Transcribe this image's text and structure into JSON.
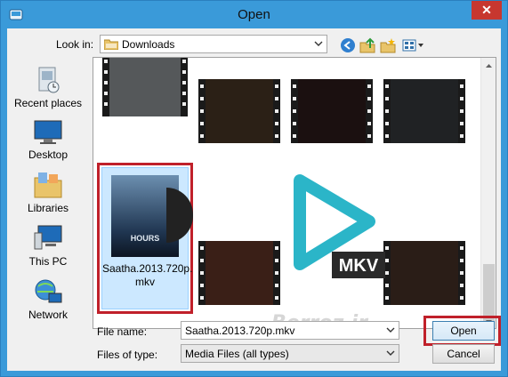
{
  "window": {
    "title": "Open",
    "close_glyph": "✕",
    "title_bar_color": "#3a9ad9"
  },
  "lookin": {
    "label": "Look in:",
    "value": "Downloads"
  },
  "toolbar": {
    "icons": [
      "back-icon",
      "up-folder-icon",
      "new-folder-icon",
      "view-menu-icon"
    ]
  },
  "places": [
    {
      "label": "Recent places",
      "icon": "recent-places-icon"
    },
    {
      "label": "Desktop",
      "icon": "desktop-icon"
    },
    {
      "label": "Libraries",
      "icon": "libraries-icon"
    },
    {
      "label": "This PC",
      "icon": "this-pc-icon"
    },
    {
      "label": "Network",
      "icon": "network-icon"
    }
  ],
  "files": {
    "selected_name": "Saatha.2013.720p.mkv",
    "selected_name_line1": "Saatha.2013.720p.",
    "selected_name_line2": "mkv",
    "cover_text": "HOURS",
    "overlay_badge": "MKV",
    "watermark": "Berroz.ir"
  },
  "footer": {
    "file_name_label": "File name:",
    "file_name_value": "Saatha.2013.720p.mkv",
    "file_type_label": "Files of type:",
    "file_type_value": "Media Files (all types)",
    "open_label": "Open",
    "cancel_label": "Cancel"
  },
  "colors": {
    "highlight_red": "#c0202a",
    "selection_blue": "#cce8ff",
    "mkv_teal": "#2bb5c8"
  }
}
